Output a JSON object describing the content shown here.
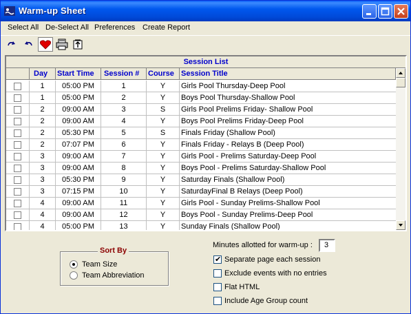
{
  "window": {
    "title": "Warm-up Sheet"
  },
  "menu": [
    "Select All",
    "De-Select All",
    "Preferences",
    "Create Report"
  ],
  "toolbar": {
    "icons": [
      "redo-icon",
      "undo-icon",
      "heart-icon",
      "print-icon",
      "export-icon"
    ]
  },
  "grid": {
    "caption": "Session List",
    "columns": [
      "",
      "Day",
      "Start Time",
      "Session #",
      "Course",
      "Session Title"
    ],
    "rows": [
      {
        "day": "1",
        "start": "05:00 PM",
        "session": "1",
        "course": "Y",
        "title": "Girls Pool Thursday-Deep Pool"
      },
      {
        "day": "1",
        "start": "05:00 PM",
        "session": "2",
        "course": "Y",
        "title": "Boys Pool Thursday-Shallow Pool"
      },
      {
        "day": "2",
        "start": "09:00 AM",
        "session": "3",
        "course": "S",
        "title": "Girls Pool Prelims Friday- Shallow Pool"
      },
      {
        "day": "2",
        "start": "09:00 AM",
        "session": "4",
        "course": "Y",
        "title": "Boys Pool Prelims Friday-Deep Pool"
      },
      {
        "day": "2",
        "start": "05:30 PM",
        "session": "5",
        "course": "S",
        "title": "Finals Friday (Shallow Pool)"
      },
      {
        "day": "2",
        "start": "07:07 PM",
        "session": "6",
        "course": "Y",
        "title": "Finals Friday - Relays B (Deep Pool)"
      },
      {
        "day": "3",
        "start": "09:00 AM",
        "session": "7",
        "course": "Y",
        "title": "Girls Pool - Prelims Saturday-Deep Pool"
      },
      {
        "day": "3",
        "start": "09:00 AM",
        "session": "8",
        "course": "Y",
        "title": "Boys Pool - Prelims Saturday-Shallow Pool"
      },
      {
        "day": "3",
        "start": "05:30 PM",
        "session": "9",
        "course": "Y",
        "title": "Saturday Finals (Shallow Pool)"
      },
      {
        "day": "3",
        "start": "07:15 PM",
        "session": "10",
        "course": "Y",
        "title": "SaturdayFinal B Relays (Deep Pool)"
      },
      {
        "day": "4",
        "start": "09:00 AM",
        "session": "11",
        "course": "Y",
        "title": "Girls Pool - Sunday Prelims-Shallow Pool"
      },
      {
        "day": "4",
        "start": "09:00 AM",
        "session": "12",
        "course": "Y",
        "title": "Boys Pool - Sunday Prelims-Deep Pool"
      },
      {
        "day": "4",
        "start": "05:00 PM",
        "session": "13",
        "course": "Y",
        "title": "Sunday Finals (Shallow Pool)"
      }
    ]
  },
  "sort": {
    "title": "Sort By",
    "options": [
      {
        "label": "Team Size",
        "selected": true
      },
      {
        "label": "Team Abbreviation",
        "selected": false
      }
    ]
  },
  "minutes": {
    "label": "Minutes allotted for warm-up :",
    "value": "3"
  },
  "options": [
    {
      "label": "Separate page each session",
      "checked": true
    },
    {
      "label": "Exclude events with no entries",
      "checked": false
    },
    {
      "label": "Flat HTML",
      "checked": false
    },
    {
      "label": "Include Age Group count",
      "checked": false
    }
  ],
  "colors": {
    "titlebar": "#0058ee",
    "header_text": "#0000cc",
    "sort_title": "#8b0000",
    "background": "#ece9d8"
  }
}
